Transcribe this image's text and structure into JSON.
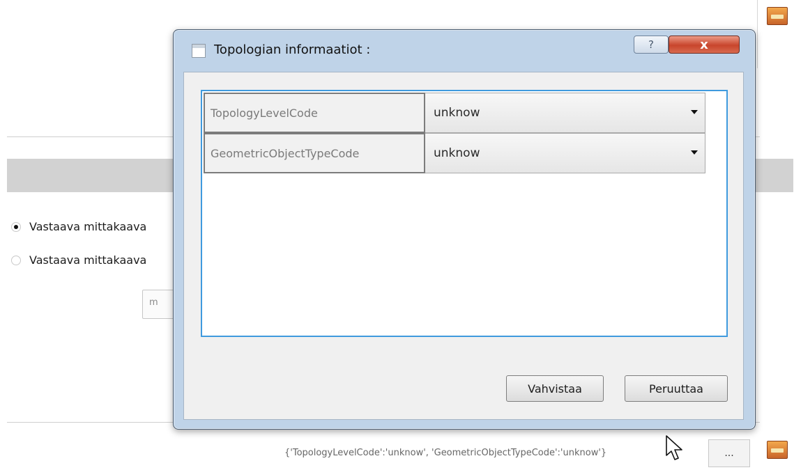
{
  "background_app": {
    "radio_options": [
      {
        "label": "Vastaava mittakaava",
        "checked": true
      },
      {
        "label": "Vastaava mittakaava",
        "checked": false
      }
    ],
    "unit_input_value": "m",
    "result_text": "{'TopologyLevelCode':'unknow', 'GeometricObjectTypeCode':'unknow'}",
    "browse_button_label": "..."
  },
  "dialog": {
    "title": "Topologian informaatiot :",
    "help_label": "?",
    "close_label": "x",
    "rows": [
      {
        "field": "TopologyLevelCode",
        "value": "unknow"
      },
      {
        "field": "GeometricObjectTypeCode",
        "value": "unknow"
      }
    ],
    "confirm_label": "Vahvistaa",
    "cancel_label": "Peruuttaa"
  },
  "colors": {
    "dialog_frame": "#bfd3e8",
    "table_focus_border": "#3f9ade",
    "close_button": "#c8452c"
  }
}
